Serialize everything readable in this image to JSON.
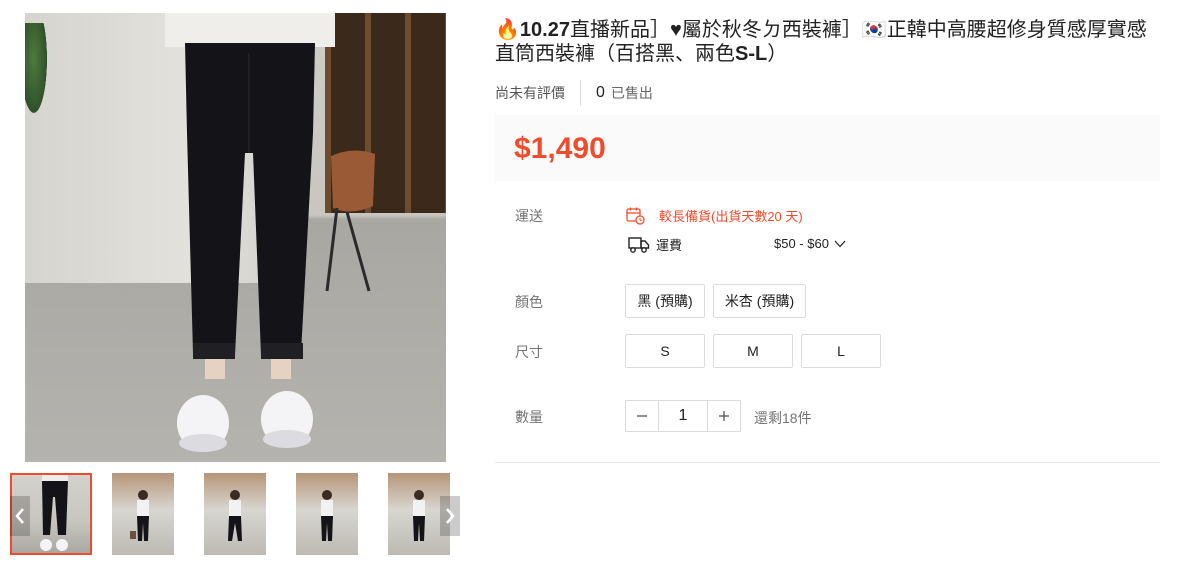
{
  "product": {
    "title_prefix_icon": "fire-emoji",
    "title_date": "10.27",
    "title_mid": "直播新品］♥屬於秋冬ㄉ西裝褲］",
    "title_flag": "korea-flag-emoji",
    "title_main": "正韓中高腰超修身質感厚實感直筒西裝褲（百搭黑、兩色",
    "title_sizes": "S-L",
    "title_end": "）",
    "rating_text": "尚未有評價",
    "sold_count": "0",
    "sold_label": "已售出",
    "price": "$1,490"
  },
  "shipping": {
    "label": "運送",
    "warning_icon": "calendar-clock-icon",
    "warning_text": "較長備貨(出貨天數20 天)",
    "fee_icon": "truck-icon",
    "fee_label": "運費",
    "fee_value": "$50 - $60",
    "fee_dropdown_icon": "chevron-down-icon"
  },
  "color": {
    "label": "顏色",
    "options": [
      "黑 (預購)",
      "米杏 (預購)"
    ]
  },
  "size": {
    "label": "尺寸",
    "options": [
      "S",
      "M",
      "L"
    ]
  },
  "quantity": {
    "label": "數量",
    "value": "1",
    "stock_text": "還剩18件"
  },
  "gallery": {
    "thumb_count": 5,
    "active_index": 0
  },
  "colors": {
    "accent": "#ee4d2d",
    "price_bg": "#fafafa"
  }
}
